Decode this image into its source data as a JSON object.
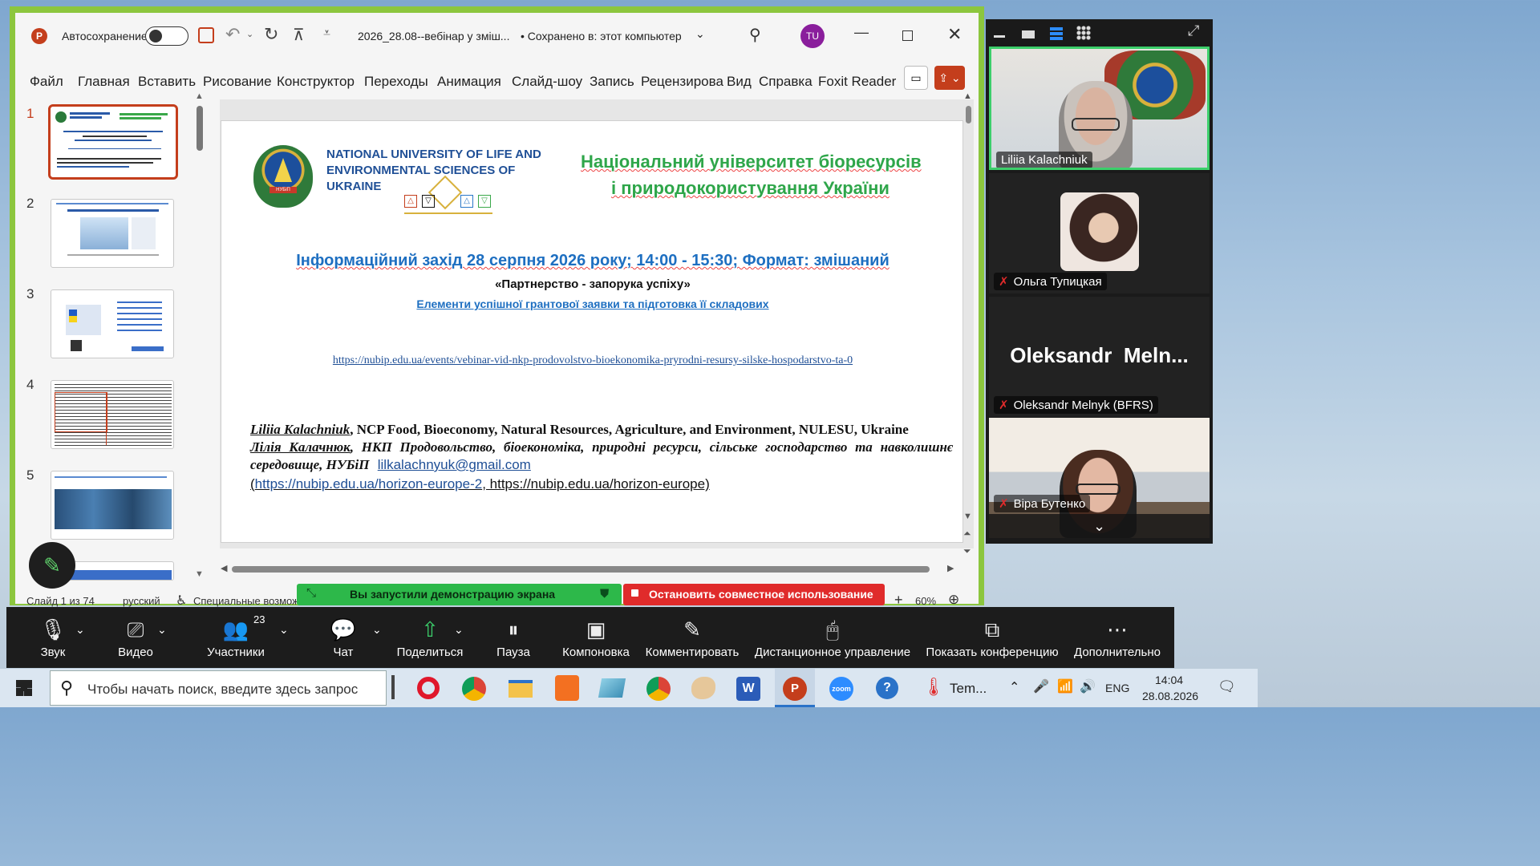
{
  "ppt": {
    "autosave_label": "Автосохранение",
    "filename": "2026_28.08--вебінар у зміш...",
    "saved_status": "• Сохранено в: этот компьютер",
    "user_initials": "TU",
    "menu": [
      "Файл",
      "Главная",
      "Вставить",
      "Рисование",
      "Конструктор",
      "Переходы",
      "Анимация",
      "Слайд-шоу",
      "Запись",
      "Рецензирова",
      "Вид",
      "Справка",
      "Foxit Reader F"
    ],
    "thumbnails": [
      "1",
      "2",
      "3",
      "4",
      "5"
    ],
    "status": {
      "slide_counter": "Слайд 1 из 74",
      "language": "русский",
      "accessibility": "Специальные возмож",
      "zoom": "60%"
    }
  },
  "slide": {
    "uni_en": "NATIONAL UNIVERSITY OF LIFE AND ENVIRONMENTAL SCIENCES OF UKRAINE",
    "uni_ua_1": "Національний університет біоресурсів",
    "uni_ua_2": "і природокористування України",
    "event": "Інформаційний захід 28 серпня 2026 року; 14:00 - 15:30; Формат: змішаний",
    "subtitle1": "«Партнерство - запорука успіху»",
    "subtitle2": "Елементи успішної грантової заявки та підготовка її складових",
    "url": "https://nubip.edu.ua/events/vebinar-vid-nkp-prodovolstvo-bioekonomika-pryrodni-resursy-silske-hospodarstvo-ta-0",
    "author_en_name": "Liliia Kalachniuk",
    "author_en_rest": ", NCP Food, Bioeconomy, Natural Resources, Agriculture, and Environment, NULESU, Ukraine",
    "author_ua_name": "Лілія Калачнюк",
    "author_ua_rest": ", НКП Продовольство, біоекономіка, природні ресурси, сільське господарство та навколишнє середовище, НУБіП",
    "email": "lilkalachnyuk@gmail.com",
    "link1": "https://nubip.edu.ua/horizon-europe-2",
    "link2": ", https://nubip.edu.ua/horizon-europe)"
  },
  "share": {
    "sharing_msg": "Вы запустили демонстрацию экрана",
    "stop_msg": "Остановить совместное использование"
  },
  "zoom_panel": {
    "participants": [
      {
        "name": "Liliia Kalachniuk"
      },
      {
        "name": "Ольга Тупицкая"
      },
      {
        "name": "Oleksandr Melnyk (BFRS)",
        "big_name": "Oleksandr  Meln..."
      },
      {
        "name": "Віра Бутенко"
      }
    ]
  },
  "meeting_toolbar": {
    "buttons": [
      "Звук",
      "Видео",
      "Участники",
      "Чат",
      "Поделиться",
      "Пауза",
      "Компоновка",
      "Комментировать",
      "Дистанционное управление",
      "Показать конференцию",
      "Дополнительно"
    ],
    "participants_count": "23"
  },
  "taskbar": {
    "search_placeholder": "Чтобы начать поиск, введите здесь запрос",
    "weather": "Tem...",
    "lang": "ENG",
    "time": "14:04",
    "date": "28.08.2026"
  },
  "colors": {
    "ppt_accent": "#c43e1c",
    "share_green": "#2db84a",
    "share_red": "#e02b2b",
    "window_border": "#8cc63e"
  }
}
